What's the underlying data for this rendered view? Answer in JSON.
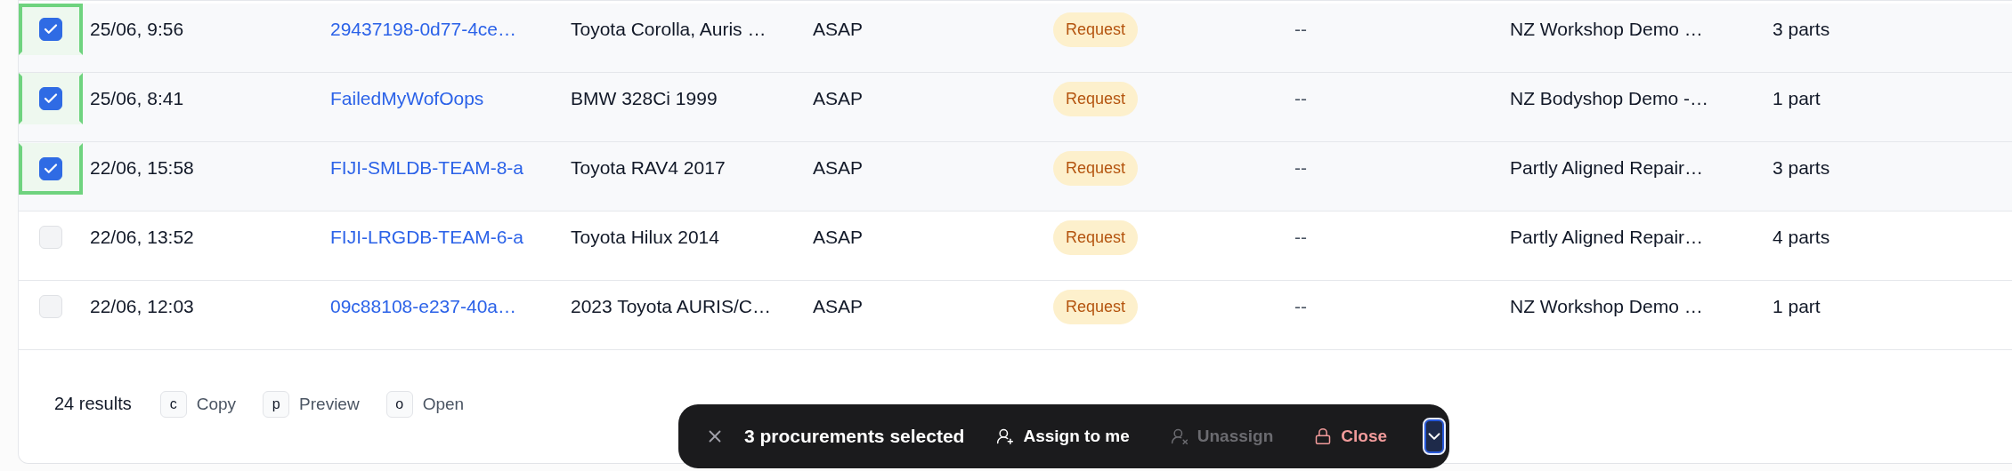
{
  "rows": [
    {
      "selected": true,
      "highlighted": true,
      "date": "25/06, 9:56",
      "reference": "29437198-0d77-4ce…",
      "vehicle": "Toyota Corolla, Auris …",
      "urgency": "ASAP",
      "status": "Request",
      "column_6": "--",
      "workshop": "NZ Workshop Demo …",
      "parts": "3 parts"
    },
    {
      "selected": true,
      "highlighted": true,
      "date": "25/06, 8:41",
      "reference": "FailedMyWofOops",
      "vehicle": "BMW 328Ci 1999",
      "urgency": "ASAP",
      "status": "Request",
      "column_6": "--",
      "workshop": "NZ Bodyshop Demo -…",
      "parts": "1 part"
    },
    {
      "selected": true,
      "highlighted": true,
      "date": "22/06, 15:58",
      "reference": "FIJI-SMLDB-TEAM-8-a",
      "vehicle": "Toyota RAV4 2017",
      "urgency": "ASAP",
      "status": "Request",
      "column_6": "--",
      "workshop": "Partly Aligned Repair…",
      "parts": "3 parts"
    },
    {
      "selected": false,
      "highlighted": false,
      "date": "22/06, 13:52",
      "reference": "FIJI-LRGDB-TEAM-6-a",
      "vehicle": "Toyota Hilux 2014",
      "urgency": "ASAP",
      "status": "Request",
      "column_6": "--",
      "workshop": "Partly Aligned Repair…",
      "parts": "4 parts"
    },
    {
      "selected": false,
      "highlighted": false,
      "date": "22/06, 12:03",
      "reference": "09c88108-e237-40a…",
      "vehicle": "2023 Toyota AURIS/C…",
      "urgency": "ASAP",
      "status": "Request",
      "column_6": "--",
      "workshop": "NZ Workshop Demo …",
      "parts": "1 part"
    }
  ],
  "footer": {
    "results": "24 results",
    "shortcuts": [
      {
        "key": "c",
        "label": "Copy"
      },
      {
        "key": "p",
        "label": "Preview"
      },
      {
        "key": "o",
        "label": "Open"
      }
    ]
  },
  "action_bar": {
    "text": "3 procurements selected",
    "actions": [
      {
        "kind": "assign",
        "label": "Assign to me",
        "disabled": false
      },
      {
        "kind": "unassign",
        "label": "Unassign",
        "disabled": true
      },
      {
        "kind": "close",
        "label": "Close",
        "disabled": false
      }
    ]
  }
}
